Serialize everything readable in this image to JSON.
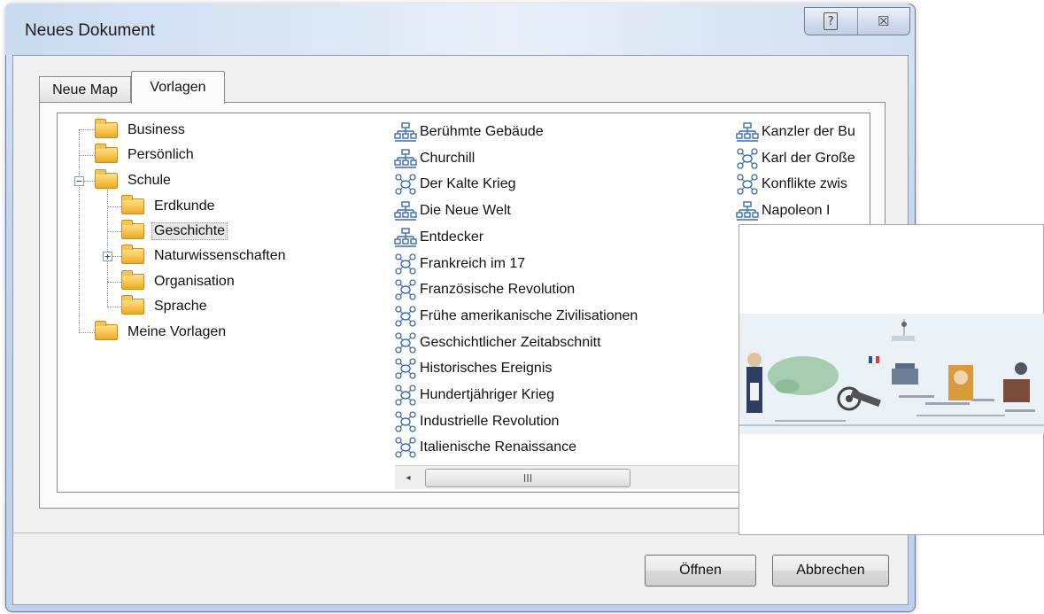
{
  "window": {
    "title": "Neues Dokument",
    "help_glyph": "?",
    "close_glyph": "☒"
  },
  "tabs": [
    {
      "label": "Neue Map",
      "active": false
    },
    {
      "label": "Vorlagen",
      "active": true
    }
  ],
  "tree": {
    "items": [
      {
        "label": "Business",
        "depth": 0
      },
      {
        "label": "Persönlich",
        "depth": 0
      },
      {
        "label": "Schule",
        "depth": 0,
        "expanded": true
      },
      {
        "label": "Erdkunde",
        "depth": 1
      },
      {
        "label": "Geschichte",
        "depth": 1,
        "selected": true
      },
      {
        "label": "Naturwissenschaften",
        "depth": 1,
        "collapsed": true
      },
      {
        "label": "Organisation",
        "depth": 1
      },
      {
        "label": "Sprache",
        "depth": 1
      },
      {
        "label": "Meine Vorlagen",
        "depth": 0
      }
    ],
    "expander_minus": "−",
    "expander_plus": "+"
  },
  "templates": {
    "column1": [
      {
        "label": "Berühmte Gebäude",
        "icon": "org-chart-icon"
      },
      {
        "label": "Churchill",
        "icon": "org-chart-icon"
      },
      {
        "label": "Der Kalte Krieg",
        "icon": "mind-map-icon"
      },
      {
        "label": "Die Neue Welt",
        "icon": "org-chart-icon"
      },
      {
        "label": "Entdecker",
        "icon": "org-chart-icon"
      },
      {
        "label": "Frankreich im 17",
        "icon": "mind-map-icon"
      },
      {
        "label": "Französische Revolution",
        "icon": "mind-map-icon"
      },
      {
        "label": "Frühe amerikanische Zivilisationen",
        "icon": "mind-map-icon"
      },
      {
        "label": "Geschichtlicher Zeitabschnitt",
        "icon": "mind-map-icon"
      },
      {
        "label": "Historisches Ereignis",
        "icon": "mind-map-icon"
      },
      {
        "label": "Hundertjähriger Krieg",
        "icon": "mind-map-icon"
      },
      {
        "label": "Industrielle Revolution",
        "icon": "mind-map-icon"
      },
      {
        "label": "Italienische Renaissance",
        "icon": "mind-map-icon"
      }
    ],
    "column2": [
      {
        "label": "Kanzler der Bu",
        "icon": "org-chart-icon"
      },
      {
        "label": "Karl der Große",
        "icon": "mind-map-icon"
      },
      {
        "label": "Konflikte zwis",
        "icon": "mind-map-icon"
      },
      {
        "label": "Napoleon I",
        "icon": "org-chart-icon"
      }
    ],
    "scroll_left_glyph": "◂",
    "scroll_thumb_grip": "III"
  },
  "preview": {
    "description_icon": "napoleon-timeline-thumbnail"
  },
  "buttons": {
    "open": "Öffnen",
    "cancel": "Abbrechen"
  }
}
